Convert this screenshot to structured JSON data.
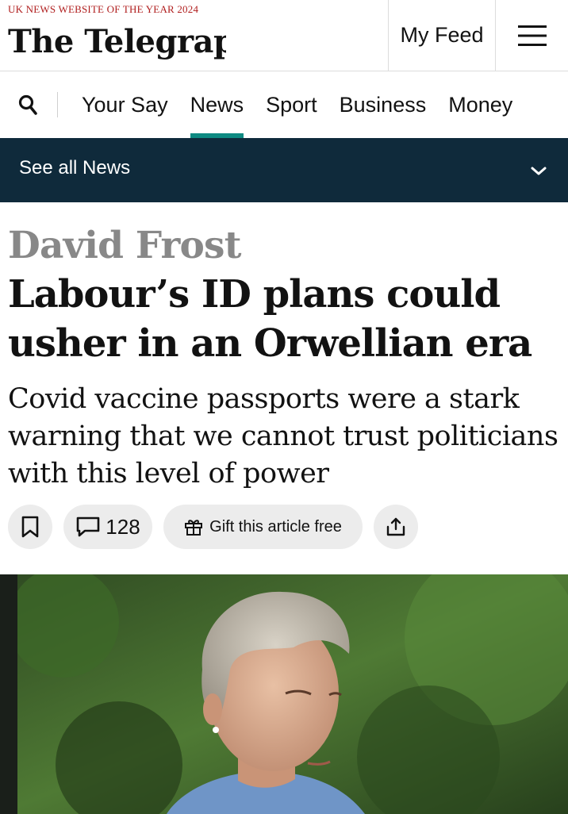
{
  "masthead": {
    "award": "UK NEWS WEBSITE OF THE YEAR 2024",
    "logo_text": "The Telegraph",
    "my_feed_label": "My Feed",
    "menu_icon": "hamburger-menu-icon"
  },
  "nav": {
    "search_icon": "search-icon",
    "items": [
      {
        "label": "Your Say",
        "active": false
      },
      {
        "label": "News",
        "active": true
      },
      {
        "label": "Sport",
        "active": false
      },
      {
        "label": "Business",
        "active": false
      },
      {
        "label": "Money",
        "active": false
      }
    ],
    "accent_color": "#0e8a82"
  },
  "section_bar": {
    "label": "See all News",
    "icon": "chevron-down-icon",
    "background": "#0f2a3b"
  },
  "article": {
    "author": "David Frost",
    "headline": "Labour’s ID plans could usher in an Orwellian era",
    "standfirst": "Covid vaccine passports were a stark warning that we cannot trust politicians with this level of power",
    "actions": {
      "bookmark_icon": "bookmark-icon",
      "comment_icon": "comment-icon",
      "comment_count": "128",
      "gift_icon": "gift-icon",
      "gift_label": "Gift this article free",
      "share_icon": "share-icon"
    },
    "hero_image": "photo of a woman with short grey hair in a blue top against green foliage"
  }
}
